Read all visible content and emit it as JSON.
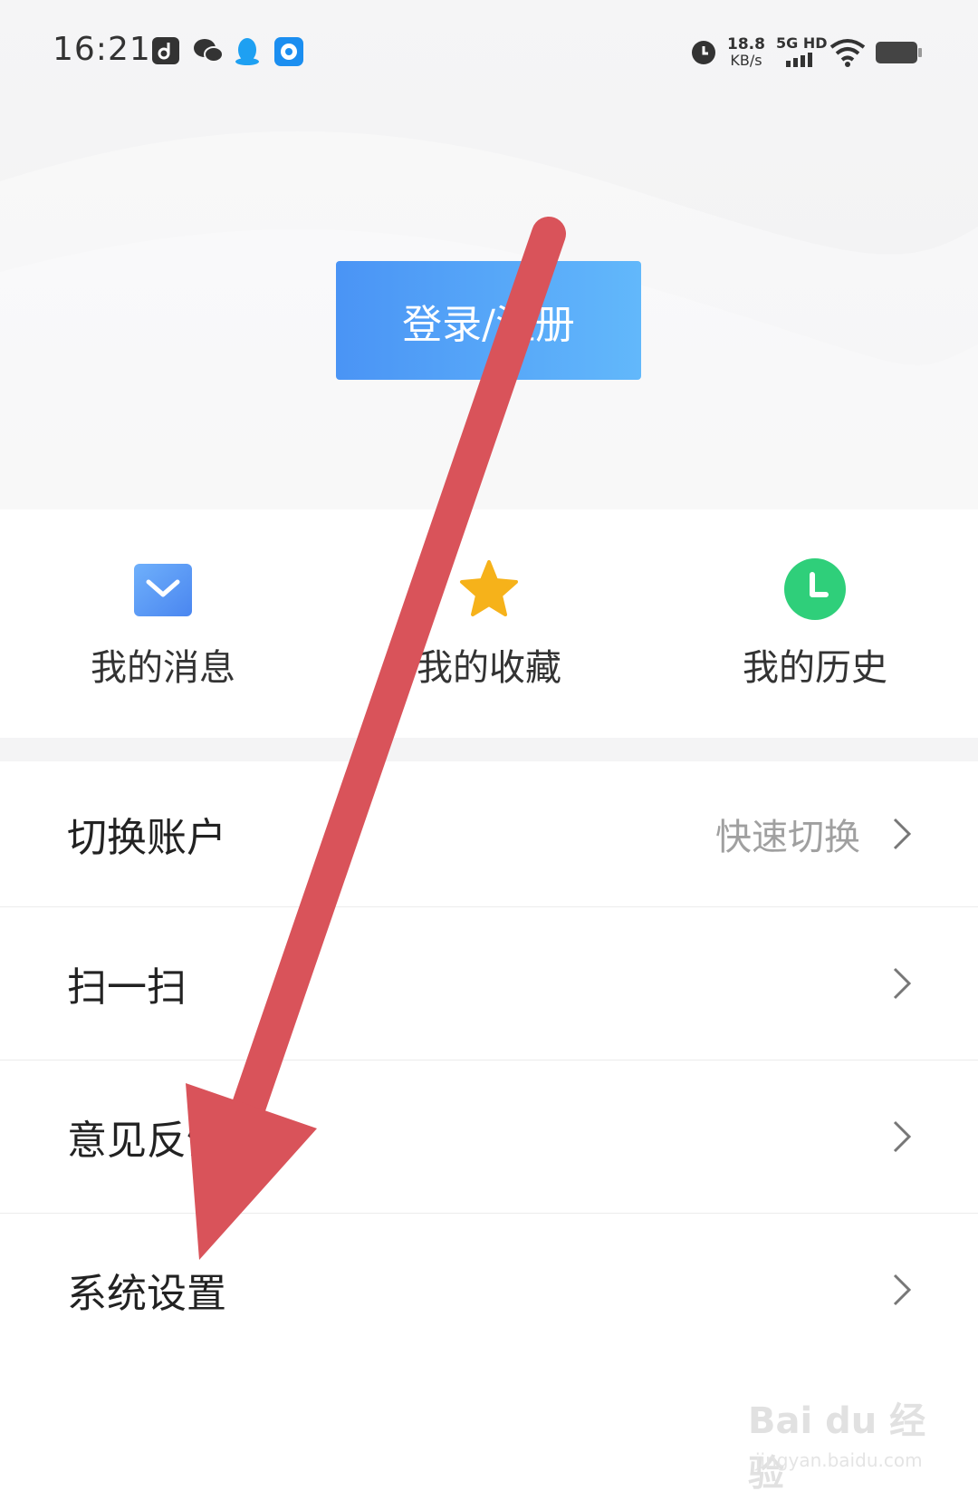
{
  "status_bar": {
    "time": "16:21",
    "net_speed_value": "18.8",
    "net_speed_unit": "KB/s",
    "network": "5G HD",
    "icons": [
      "tiktok-icon",
      "wechat-icon",
      "qq-icon",
      "message-app-icon",
      "alarm-icon",
      "signal-icon",
      "wifi-icon",
      "battery-icon"
    ]
  },
  "header": {
    "login_button": "登录/注册"
  },
  "quick_actions": [
    {
      "label": "我的消息",
      "icon": "mail-icon",
      "color": "#5b9cf5"
    },
    {
      "label": "我的收藏",
      "icon": "star-icon",
      "color": "#f6b21a"
    },
    {
      "label": "我的历史",
      "icon": "clock-icon",
      "color": "#2fcf7a"
    }
  ],
  "menu": [
    {
      "label": "切换账户",
      "value": "快速切换"
    },
    {
      "label": "扫一扫",
      "value": ""
    },
    {
      "label": "意见反馈",
      "value": ""
    },
    {
      "label": "系统设置",
      "value": ""
    }
  ],
  "annotation": {
    "color": "#d9535a"
  },
  "watermark": {
    "main": "Bai du 经验",
    "sub": "jingyan.baidu.com"
  }
}
